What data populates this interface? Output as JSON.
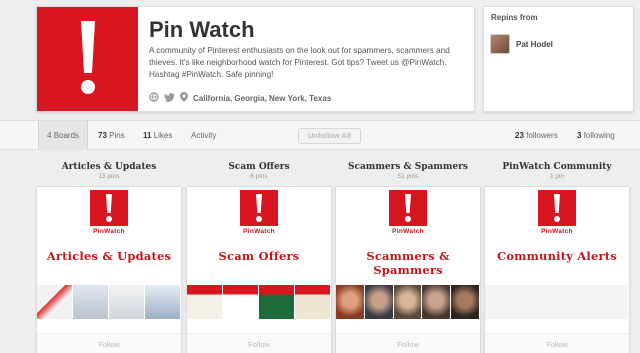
{
  "profile": {
    "name": "Pin Watch",
    "bio": "A community of Pinterest enthusiasts on the look out for spammers, scammers and thieves. It's like neighborhood watch for Pinterest. Got tips? Tweet us @PinWatch. Hashtag #PinWatch. Safe pinning!",
    "location": "California, Georgia, New York, Texas",
    "icons": [
      "globe-icon",
      "twitter-bird-icon",
      "location-pin-icon"
    ],
    "brand_color": "#d7161f"
  },
  "repins": {
    "title": "Repins from",
    "user": "Pat Hodel"
  },
  "stats": {
    "boards_count": "4",
    "boards_label": "Boards",
    "pins_count": "73",
    "pins_label": "Pins",
    "likes_count": "11",
    "likes_label": "Likes",
    "activity_label": "Activity",
    "unfollow_label": "Unfollow All",
    "followers_count": "23",
    "followers_label": "followers",
    "following_count": "3",
    "following_label": "following"
  },
  "boards": [
    {
      "title": "Articles & Updates",
      "count": "15 pins",
      "brand": "PinWatch",
      "heading": "Articles & Updates",
      "follow": "Follow"
    },
    {
      "title": "Scam Offers",
      "count": "6 pins",
      "brand": "PinWatch",
      "heading": "Scam Offers",
      "follow": "Follow"
    },
    {
      "title": "Scammers & Spammers",
      "count": "51 pins",
      "brand": "PinWatch",
      "heading": "Scammers & Spammers",
      "follow": "Follow"
    },
    {
      "title": "PinWatch Community",
      "count": "1 pin",
      "brand": "PinWatch",
      "heading": "Community Alerts",
      "follow": "Follow"
    }
  ]
}
